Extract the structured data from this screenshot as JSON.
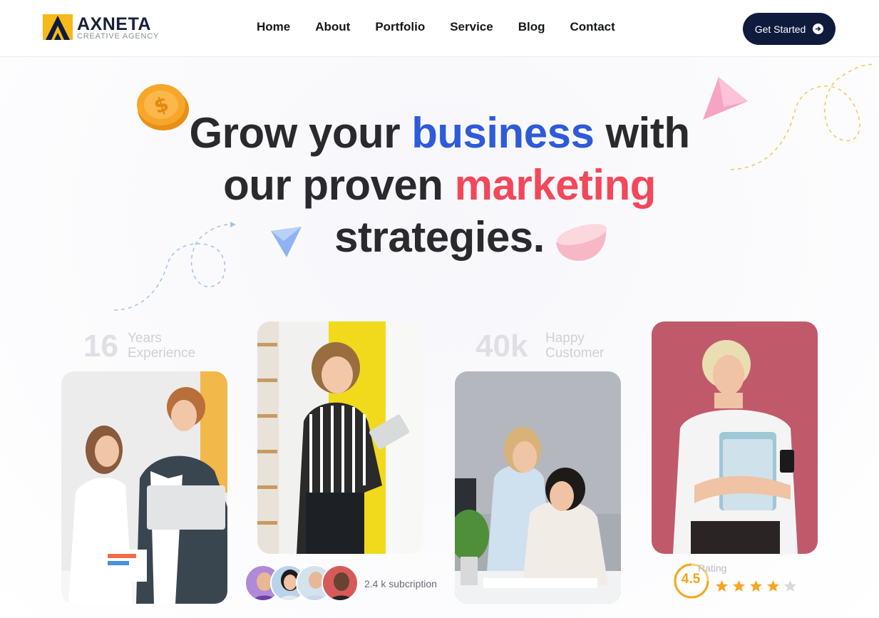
{
  "brand": {
    "name": "AXNETA",
    "tagline": "CREATIVE AGENCY",
    "colors": {
      "navy": "#0e1b3d",
      "yellow": "#f6b91a",
      "blue": "#2f5bd9",
      "red": "#f1485a"
    }
  },
  "nav": {
    "items": [
      "Home",
      "About",
      "Portfolio",
      "Service",
      "Blog",
      "Contact"
    ],
    "cta_label": "Get Started",
    "cta_icon": "arrow-right-circle-icon"
  },
  "hero": {
    "line1_a": "Grow your",
    "line1_highlight": "business",
    "line1_b": "with",
    "line2_a": "our proven",
    "line2_highlight": "marketing",
    "line3": "strategies."
  },
  "stats": {
    "experience": {
      "number": "16",
      "label_1": "Years",
      "label_2": "Experience"
    },
    "customers": {
      "number": "40k",
      "label_1": "Happy",
      "label_2": "Customer"
    }
  },
  "subscription": {
    "text": "2.4 k subcription"
  },
  "rating": {
    "label": "Rating",
    "value": "4.5",
    "stars_filled": 4,
    "stars_total": 5
  },
  "icons": [
    "dollar-coin-icon",
    "pink-triangle-icon",
    "blue-triangle-icon",
    "pink-bowl-icon",
    "star-icon"
  ]
}
